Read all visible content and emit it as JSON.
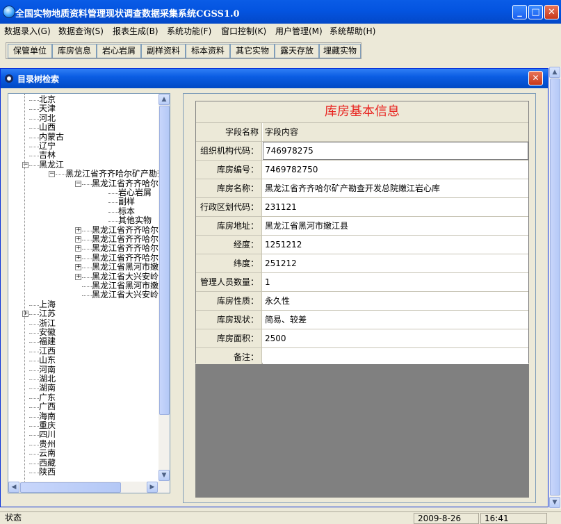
{
  "window": {
    "title": "全国实物地质资料管理现状调查数据采集系统CGSS1.0"
  },
  "menu": [
    "数据录入(G)",
    "数据查询(S)",
    "报表生成(B)",
    "系统功能(F)",
    "窗口控制(K)",
    "用户管理(M)",
    "系统帮助(H)"
  ],
  "toolbar": [
    "保管单位",
    "库房信息",
    "岩心岩屑",
    "副样资料",
    "标本资料",
    "其它实物",
    "露天存放",
    "埋藏实物"
  ],
  "child": {
    "title": "目录树检索",
    "close_glyph": "✕"
  },
  "tree": {
    "top_level": [
      "北京",
      "天津",
      "河北",
      "山西",
      "内蒙古",
      "辽宁",
      "吉林",
      "黑龙江"
    ],
    "hlj_child": "黑龙江省齐齐哈尔矿产勘查",
    "hlj_sub": "黑龙江省齐齐哈尔",
    "hlj_leaves": [
      "岩心岩屑",
      "副样",
      "标本",
      "其他实物"
    ],
    "hlj_siblings": [
      "黑龙江省齐齐哈尔",
      "黑龙江省齐齐哈尔",
      "黑龙江省齐齐哈尔",
      "黑龙江省齐齐哈尔",
      "黑龙江省黑河市嫩",
      "黑龙江省大兴安岭",
      "黑龙江省黑河市嫩",
      "黑龙江省大兴安岭"
    ],
    "bottom_level": [
      "上海",
      "江苏",
      "浙江",
      "安徽",
      "福建",
      "江西",
      "山东",
      "河南",
      "湖北",
      "湖南",
      "广东",
      "广西",
      "海南",
      "重庆",
      "四川",
      "贵州",
      "云南",
      "西藏",
      "陕西"
    ]
  },
  "info": {
    "title": "库房基本信息",
    "header": {
      "label": "字段名称",
      "value": "字段内容"
    },
    "rows": [
      {
        "label": "组织机构代码：",
        "value": "746978275"
      },
      {
        "label": "库房编号：",
        "value": "7469782750"
      },
      {
        "label": "库房名称：",
        "value": "黑龙江省齐齐哈尔矿产勘查开发总院嫩江岩心库"
      },
      {
        "label": "行政区划代码：",
        "value": "231121"
      },
      {
        "label": "库房地址：",
        "value": "黑龙江省黑河市嫩江县"
      },
      {
        "label": "经度：",
        "value": "1251212"
      },
      {
        "label": "纬度：",
        "value": "251212"
      },
      {
        "label": "管理人员数量：",
        "value": "1"
      },
      {
        "label": "库房性质：",
        "value": "永久性"
      },
      {
        "label": "库房现状：",
        "value": "简易、较差"
      },
      {
        "label": "库房面积：",
        "value": "2500"
      },
      {
        "label": "备注：",
        "value": ""
      }
    ]
  },
  "status": {
    "label": "状态",
    "date": "2009-8-26",
    "time": "16:41"
  },
  "colors": {
    "title_bar": "#0454e0",
    "info_title": "#e8221e",
    "panel_gray": "#808080"
  }
}
